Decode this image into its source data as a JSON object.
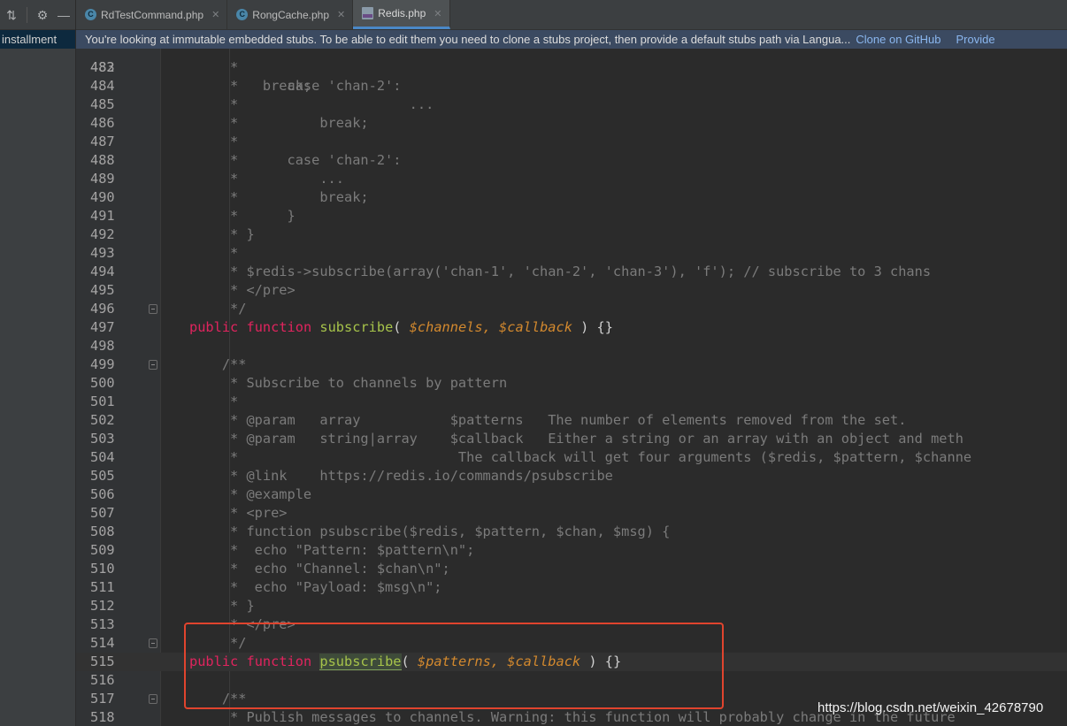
{
  "left_panel": {
    "item_label": "installment"
  },
  "tabs": [
    {
      "label": "RdTestCommand.php",
      "icon": "php-class-icon",
      "active": false
    },
    {
      "label": "RongCache.php",
      "icon": "php-class-icon",
      "active": false
    },
    {
      "label": "Redis.php",
      "icon": "php-stub-file-icon",
      "active": true
    }
  ],
  "banner": {
    "message": "You're looking at immutable embedded stubs. To be able to edit them you need to clone a stubs project, then provide a default stubs path via Langua...",
    "link_clone": "Clone on GitHub",
    "link_provide": "Provide"
  },
  "editor": {
    "current_line": 515,
    "partial_top_text": "         break;",
    "lines": [
      {
        "n": "483",
        "code": "     *"
      },
      {
        "n": "484",
        "code": "     *      case 'chan-2':"
      },
      {
        "n": "485",
        "code": "     *                     ..."
      },
      {
        "n": "486",
        "code": "     *          break;"
      },
      {
        "n": "487",
        "code": "     *"
      },
      {
        "n": "488",
        "code": "     *      case 'chan-2':"
      },
      {
        "n": "489",
        "code": "     *          ..."
      },
      {
        "n": "490",
        "code": "     *          break;"
      },
      {
        "n": "491",
        "code": "     *      }"
      },
      {
        "n": "492",
        "code": "     * }"
      },
      {
        "n": "493",
        "code": "     *"
      },
      {
        "n": "494",
        "code": "     * $redis->subscribe(array('chan-1', 'chan-2', 'chan-3'), 'f'); // subscribe to 3 chans"
      },
      {
        "n": "495",
        "code": "     * </pre>"
      },
      {
        "n": "496",
        "code": "     */"
      },
      {
        "n": "497",
        "code": "public function subscribe( $channels, $callback ) {}"
      },
      {
        "n": "498",
        "code": ""
      },
      {
        "n": "499",
        "code": "    /**"
      },
      {
        "n": "500",
        "code": "     * Subscribe to channels by pattern"
      },
      {
        "n": "501",
        "code": "     *"
      },
      {
        "n": "502",
        "code": "     * @param   array           $patterns   The number of elements removed from the set."
      },
      {
        "n": "503",
        "code": "     * @param   string|array    $callback   Either a string or an array with an object and meth"
      },
      {
        "n": "504",
        "code": "     *                           The callback will get four arguments ($redis, $pattern, $channe"
      },
      {
        "n": "505",
        "code": "     * @link    https://redis.io/commands/psubscribe"
      },
      {
        "n": "506",
        "code": "     * @example"
      },
      {
        "n": "507",
        "code": "     * <pre>"
      },
      {
        "n": "508",
        "code": "     * function psubscribe($redis, $pattern, $chan, $msg) {"
      },
      {
        "n": "509",
        "code": "     *  echo \"Pattern: $pattern\\n\";"
      },
      {
        "n": "510",
        "code": "     *  echo \"Channel: $chan\\n\";"
      },
      {
        "n": "511",
        "code": "     *  echo \"Payload: $msg\\n\";"
      },
      {
        "n": "512",
        "code": "     * }"
      },
      {
        "n": "513",
        "code": "     * </pre>"
      },
      {
        "n": "514",
        "code": "     */"
      },
      {
        "n": "515",
        "code": "public function psubscribe( $patterns, $callback ) {}"
      },
      {
        "n": "516",
        "code": ""
      },
      {
        "n": "517",
        "code": "    /**"
      },
      {
        "n": "518",
        "code": "     * Publish messages to channels. Warning: this function will probably change in the future"
      }
    ],
    "fn_497": {
      "kw1": "public",
      "kw2": "function",
      "name": "subscribe",
      "open": "( ",
      "p1": "$channels,",
      "p2": "$callback",
      "close": " ) {}"
    },
    "fn_515": {
      "kw1": "public",
      "kw2": "function",
      "name": "psubscribe",
      "open": "( ",
      "p1": "$patterns,",
      "p2": "$callback",
      "close": " ) {}"
    }
  },
  "watermark": "https://blog.csdn.net/weixin_42678790"
}
